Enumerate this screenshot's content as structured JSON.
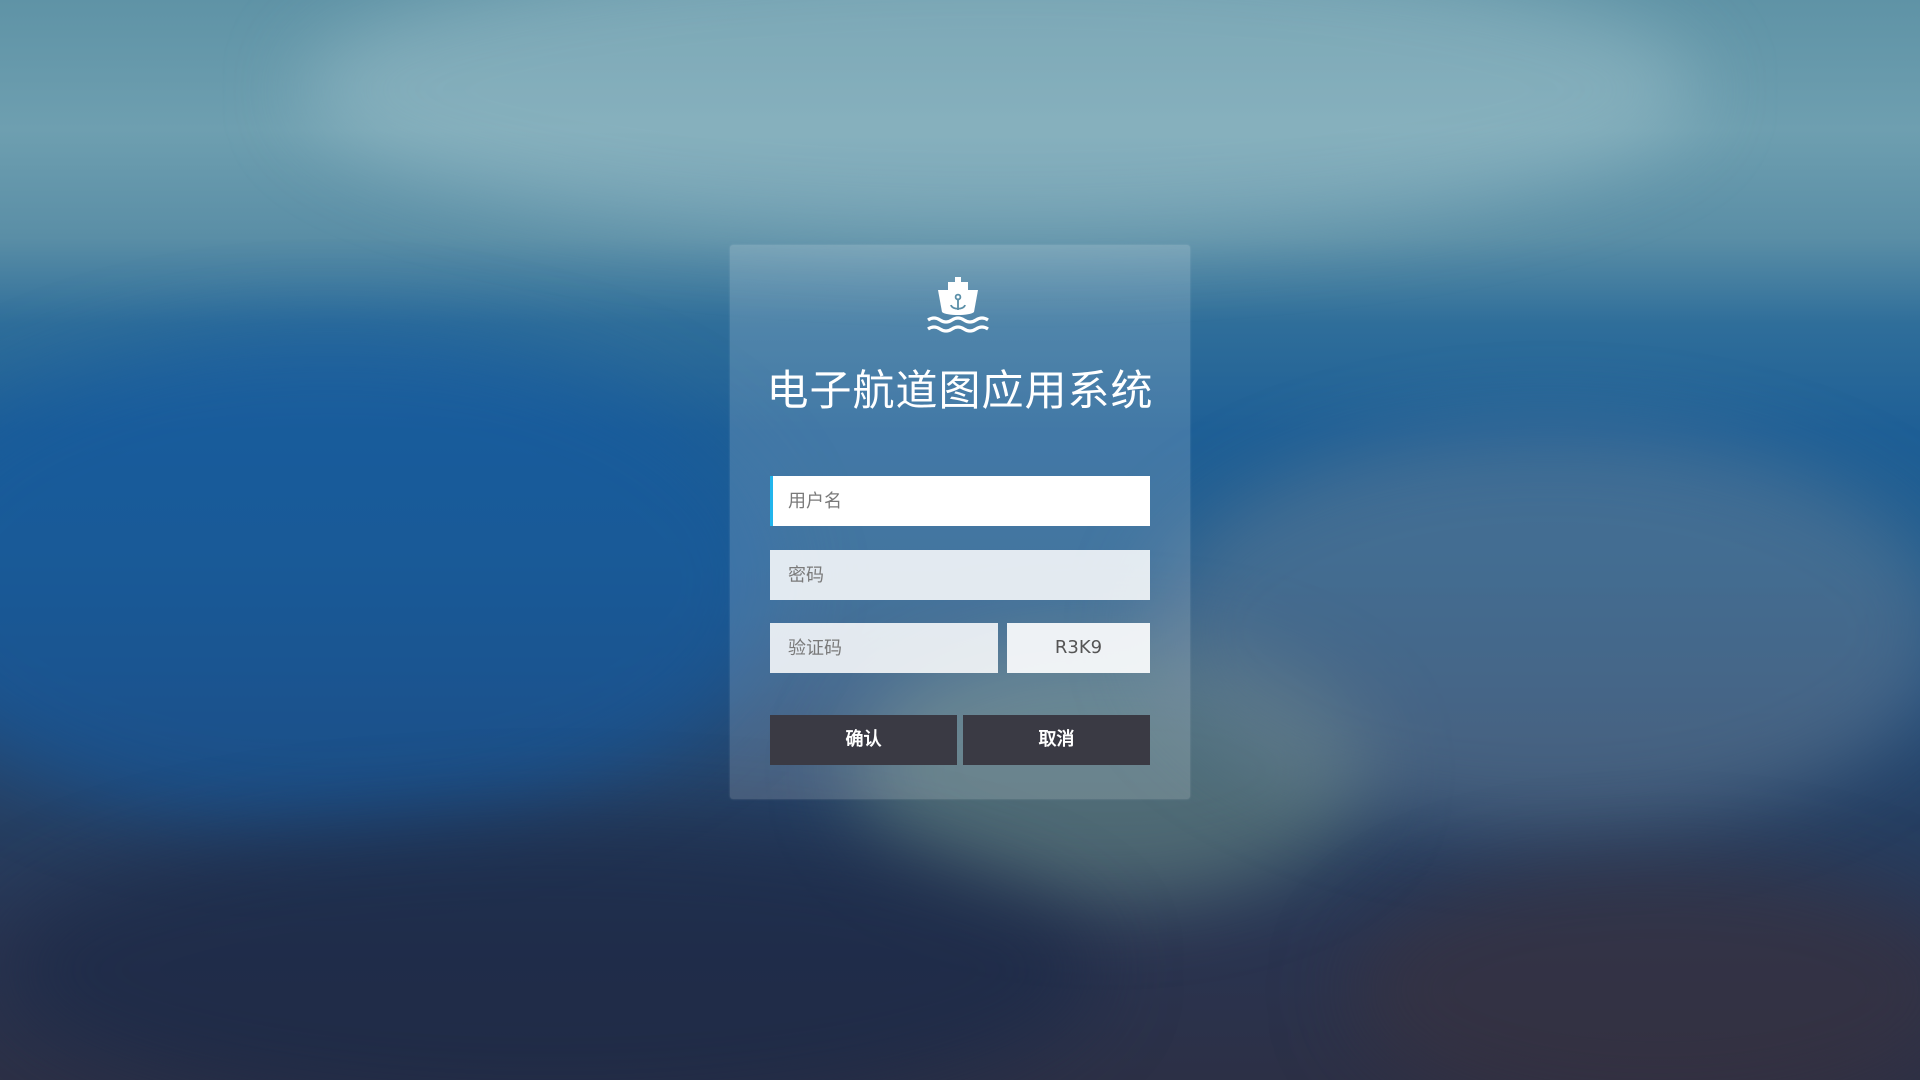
{
  "app": {
    "title": "电子航道图应用系统",
    "logo_icon": "ship-anchor-icon"
  },
  "form": {
    "username_placeholder": "用户名",
    "username_value": "",
    "password_placeholder": "密码",
    "password_value": "",
    "captcha_placeholder": "验证码",
    "captcha_value": "",
    "captcha_code": "R3K9",
    "confirm_label": "确认",
    "cancel_label": "取消"
  },
  "colors": {
    "button_bg": "#3a3a44",
    "focus_accent": "#22b5ec"
  }
}
